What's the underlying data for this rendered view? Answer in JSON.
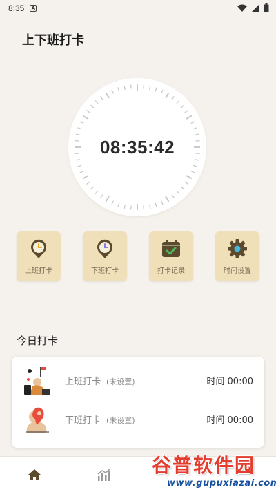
{
  "status_bar": {
    "time": "8:35",
    "badge": "A"
  },
  "header": {
    "title": "上下班打卡"
  },
  "clock": {
    "time": "08:35:42"
  },
  "actions": [
    {
      "label": "上班打卡",
      "icon": "clock-pin-icon"
    },
    {
      "label": "下班打卡",
      "icon": "clock-pin-icon"
    },
    {
      "label": "打卡记录",
      "icon": "calendar-check-icon"
    },
    {
      "label": "时间设置",
      "icon": "gear-icon"
    }
  ],
  "today": {
    "title": "今日打卡",
    "rows": [
      {
        "name": "上班打卡",
        "status": "(未设置)",
        "time": "时间 00:00"
      },
      {
        "name": "下班打卡",
        "status": "(未设置)",
        "time": "时间 00:00"
      }
    ]
  },
  "tabbar": {
    "tabs": [
      {
        "icon": "home-icon"
      },
      {
        "icon": "chart-icon"
      }
    ]
  },
  "watermark": {
    "title": "谷普软件园",
    "url": "www.gupuxiazai.com"
  },
  "colors": {
    "background": "#f5f1ec",
    "action_bg": "#efe0b9",
    "icon_brown": "#5c4a2f",
    "watermark_red": "#e33d2f",
    "watermark_blue": "#17509e"
  }
}
